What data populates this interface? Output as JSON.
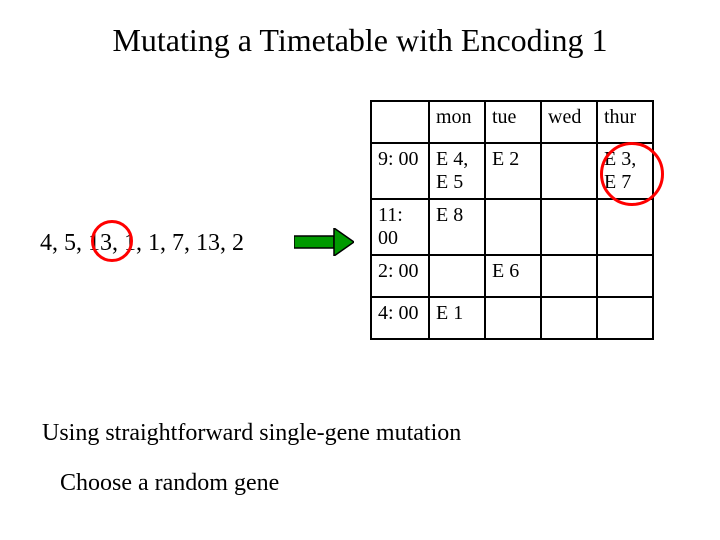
{
  "title": "Mutating a Timetable with Encoding 1",
  "sequence": {
    "g0": "4,",
    "g1": "5,",
    "g2": "13,",
    "g3": "1,",
    "g4": "1,",
    "g5": "7,",
    "g6": "13,",
    "g7": "2"
  },
  "headers": {
    "mon": "mon",
    "tue": "tue",
    "wed": "wed",
    "thur": "thur"
  },
  "rows": {
    "r0": {
      "time": "9: 00",
      "mon": "E 4, E 5",
      "tue": "E 2",
      "wed": "",
      "thur": "E 3, E 7"
    },
    "r1": {
      "time": "11: 00",
      "mon": "E 8",
      "tue": "",
      "wed": "",
      "thur": ""
    },
    "r2": {
      "time": "2: 00",
      "mon": "",
      "tue": "E 6",
      "wed": "",
      "thur": ""
    },
    "r3": {
      "time": "4: 00",
      "mon": "E 1",
      "tue": "",
      "wed": "",
      "thur": ""
    }
  },
  "body": {
    "line1": "Using straightforward single-gene mutation",
    "line2": "Choose a random gene"
  }
}
